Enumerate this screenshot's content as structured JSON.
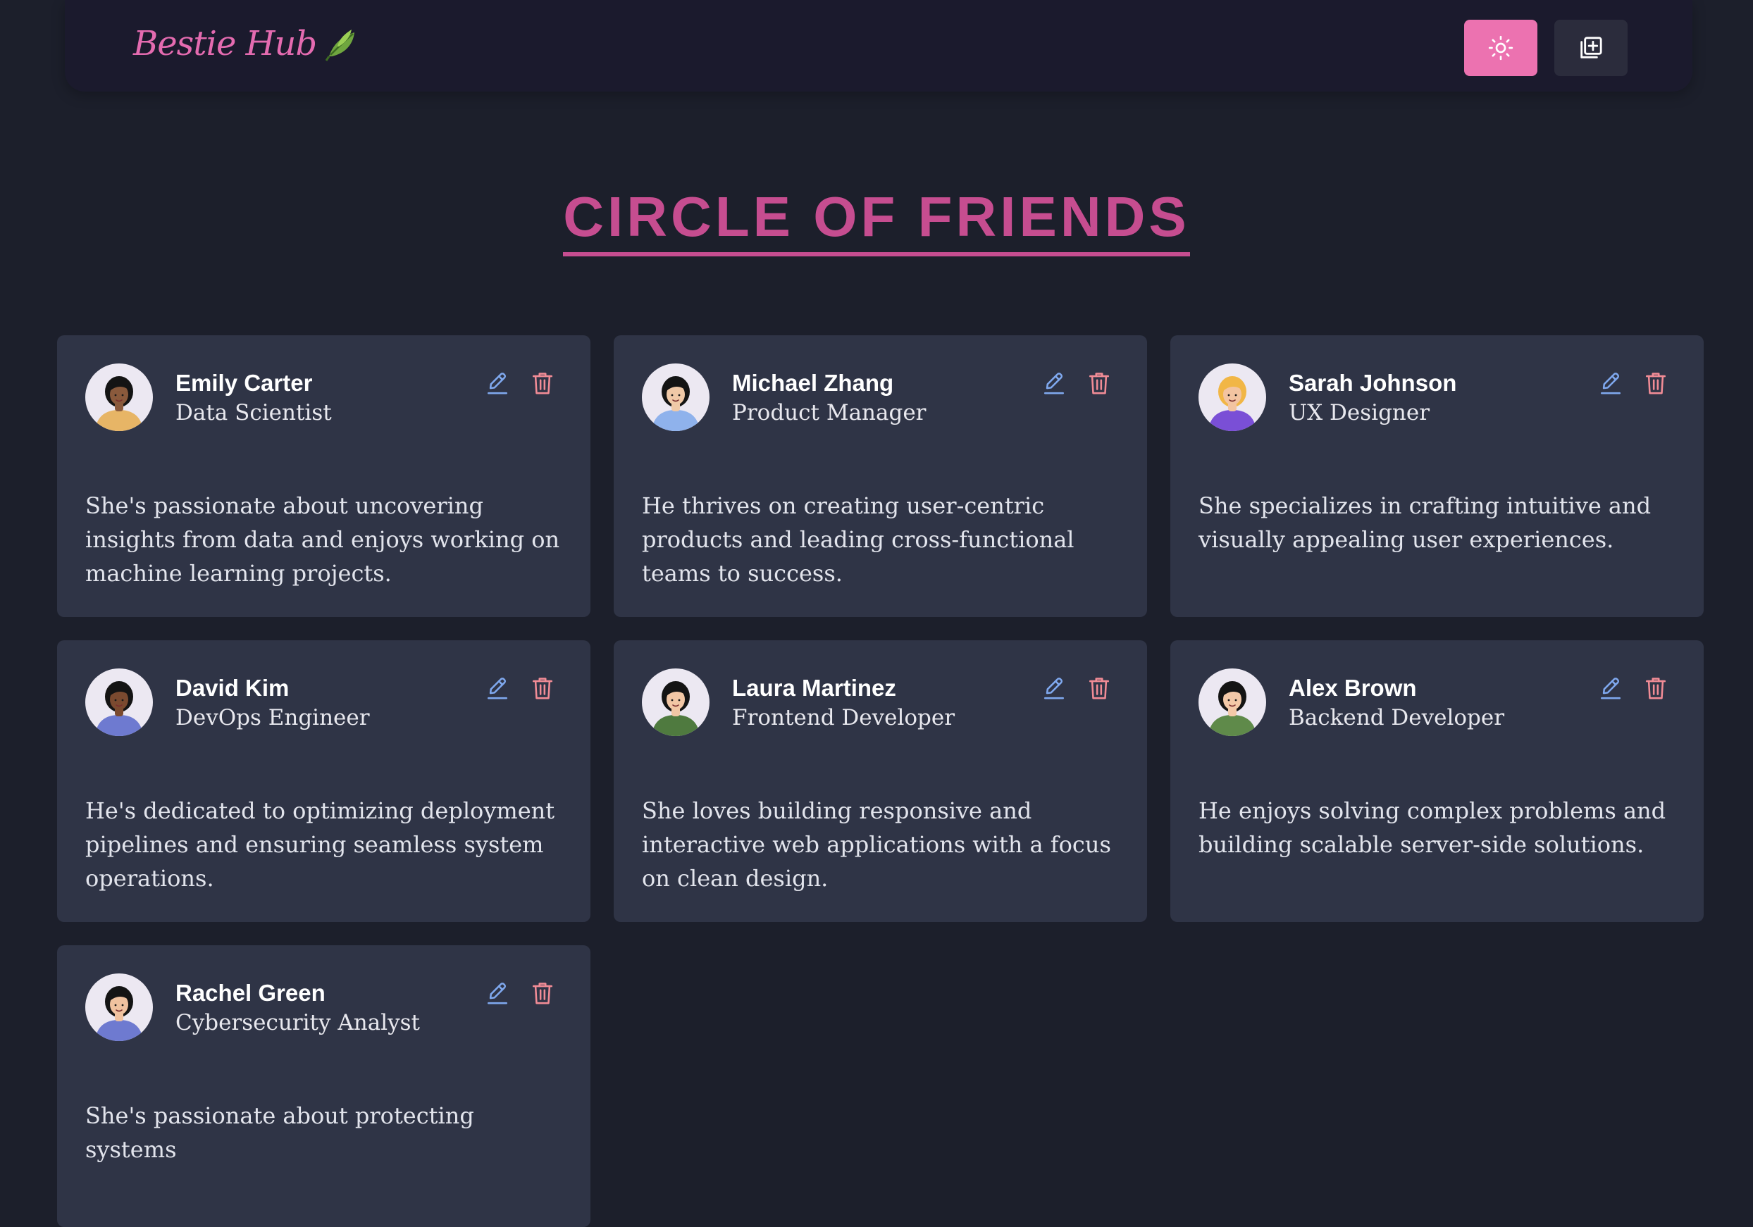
{
  "app": {
    "title": "Bestie Hub",
    "accent": "#e46bb0"
  },
  "nav": {
    "theme_icon": "sun-icon",
    "add_icon": "add-square-icon"
  },
  "page": {
    "heading": "CIRCLE OF FRIENDS"
  },
  "friends": [
    {
      "name": "Emily Carter",
      "role": "Data Scientist",
      "bio": "She's passionate about uncovering insights from data and enjoys working on machine learning projects.",
      "skin": "#8a5a3c",
      "hair": "#141414",
      "shirt": "#e7b566"
    },
    {
      "name": "Michael Zhang",
      "role": "Product Manager",
      "bio": "He thrives on creating user-centric products and leading cross-functional teams to success.",
      "skin": "#f0c9a7",
      "hair": "#141414",
      "shirt": "#8fb2ec"
    },
    {
      "name": "Sarah Johnson",
      "role": "UX Designer",
      "bio": "She specializes in crafting intuitive and visually appealing user experiences.",
      "skin": "#f3c4a1",
      "hair": "#f1b646",
      "shirt": "#7a4fd6"
    },
    {
      "name": "David Kim",
      "role": "DevOps Engineer",
      "bio": "He's dedicated to optimizing deployment pipelines and ensuring seamless system operations.",
      "skin": "#7b4a2f",
      "hair": "#141414",
      "shirt": "#6e7ad0"
    },
    {
      "name": "Laura Martinez",
      "role": "Frontend Developer",
      "bio": "She loves building responsive and interactive web applications with a focus on clean design.",
      "skin": "#f2c7a5",
      "hair": "#141414",
      "shirt": "#4f7a3f"
    },
    {
      "name": "Alex Brown",
      "role": "Backend Developer",
      "bio": "He enjoys solving complex problems and building scalable server-side solutions.",
      "skin": "#f3c9a8",
      "hair": "#141414",
      "shirt": "#5f8a4a"
    },
    {
      "name": "Rachel Green",
      "role": "Cybersecurity Analyst",
      "bio": "She's passionate about protecting systems",
      "skin": "#f0c29f",
      "hair": "#141414",
      "shirt": "#6e7ad0"
    }
  ],
  "card_actions": {
    "edit_icon": "edit-pencil-icon",
    "delete_icon": "trash-icon",
    "edit_color": "#7fa8ee",
    "delete_color": "#f28c96"
  }
}
